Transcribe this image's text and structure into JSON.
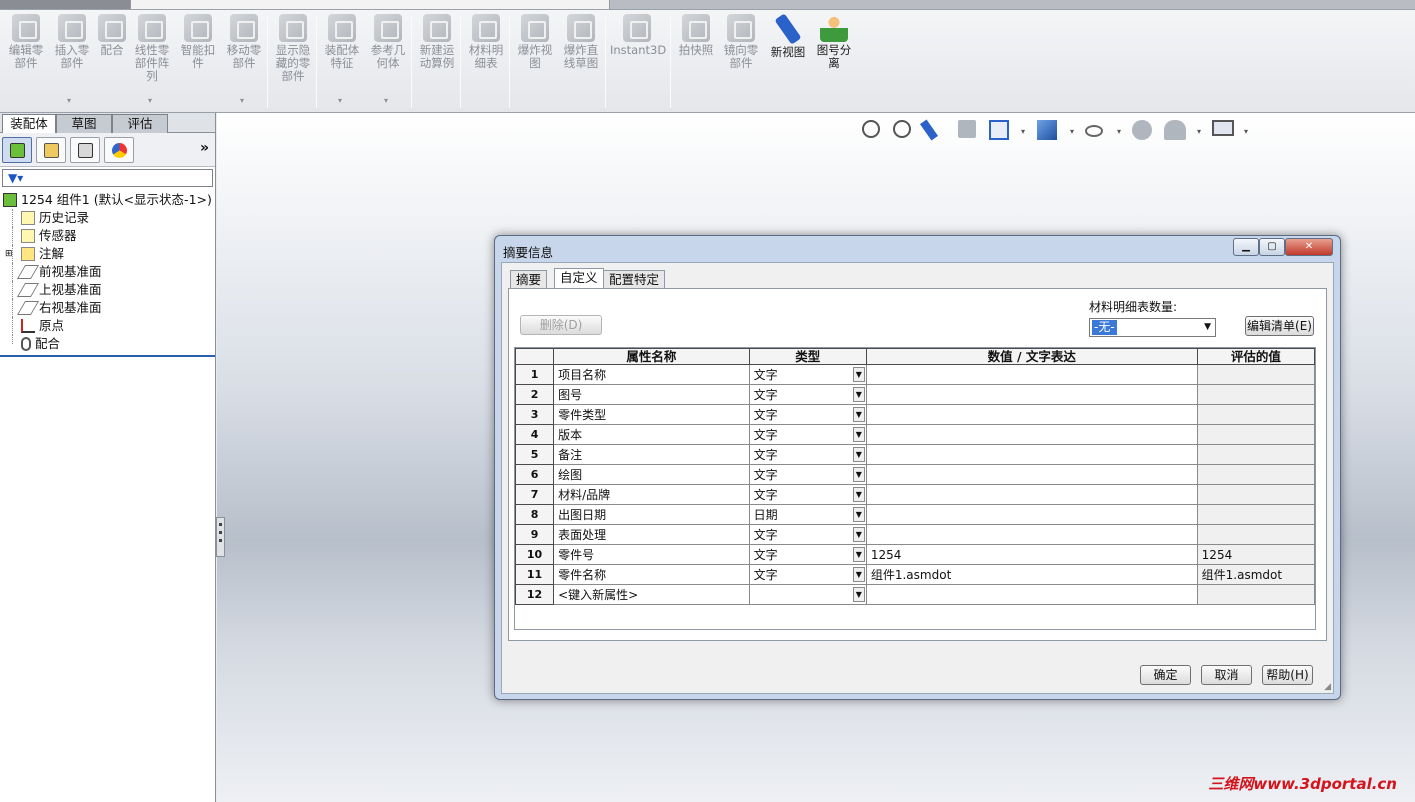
{
  "ribbon": {
    "buttons": [
      {
        "label": "编辑零\n部件",
        "icon": "edit-component-icon"
      },
      {
        "label": "插入零\n部件",
        "icon": "insert-component-icon"
      },
      {
        "label": "配合",
        "icon": "mate-icon"
      },
      {
        "label": "线性零\n部件阵\n列",
        "icon": "linear-pattern-icon"
      },
      {
        "label": "智能扣\n件",
        "icon": "smart-fastener-icon"
      },
      {
        "label": "移动零\n部件",
        "icon": "move-component-icon"
      },
      {
        "label": "显示隐\n藏的零\n部件",
        "icon": "show-hidden-icon"
      },
      {
        "label": "装配体\n特征",
        "icon": "assembly-feature-icon"
      },
      {
        "label": "参考几\n何体",
        "icon": "reference-geometry-icon"
      },
      {
        "label": "新建运\n动算例",
        "icon": "motion-study-icon"
      },
      {
        "label": "材料明\n细表",
        "icon": "bom-icon"
      },
      {
        "label": "爆炸视\n图",
        "icon": "exploded-view-icon"
      },
      {
        "label": "爆炸直\n线草图",
        "icon": "explode-line-sketch-icon"
      },
      {
        "label": "Instant3D",
        "icon": "instant3d-icon"
      },
      {
        "label": "拍快照",
        "icon": "snapshot-icon"
      },
      {
        "label": "镜向零\n部件",
        "icon": "mirror-component-icon"
      },
      {
        "label": "新视图",
        "icon": "new-view-icon"
      },
      {
        "label": "图号分\n离",
        "icon": "drawing-split-icon"
      }
    ]
  },
  "panel": {
    "tabs": [
      "装配体",
      "草图",
      "评估"
    ],
    "tree_root": "1254 组件1  (默认<显示状态-1>)",
    "tree_items": [
      "历史记录",
      "传感器",
      "注解",
      "前视基准面",
      "上视基准面",
      "右视基准面",
      "原点",
      "配合"
    ],
    "more_label": "»"
  },
  "dialog": {
    "title": "摘要信息",
    "tabs": [
      "摘要",
      "自定义",
      "配置特定"
    ],
    "delete_label": "删除(D)",
    "bom_qty_label": "材料明细表数量:",
    "bom_qty_value": "-无-",
    "edit_list_label": "编辑清单(E)",
    "columns": [
      "",
      "属性名称",
      "类型",
      "数值 / 文字表达",
      "评估的值"
    ],
    "rows": [
      {
        "num": "1",
        "name": "项目名称",
        "type": "文字",
        "value": "",
        "evaluated": ""
      },
      {
        "num": "2",
        "name": "图号",
        "type": "文字",
        "value": "",
        "evaluated": ""
      },
      {
        "num": "3",
        "name": "零件类型",
        "type": "文字",
        "value": "",
        "evaluated": ""
      },
      {
        "num": "4",
        "name": "版本",
        "type": "文字",
        "value": "",
        "evaluated": ""
      },
      {
        "num": "5",
        "name": "备注",
        "type": "文字",
        "value": "",
        "evaluated": ""
      },
      {
        "num": "6",
        "name": "绘图",
        "type": "文字",
        "value": "",
        "evaluated": ""
      },
      {
        "num": "7",
        "name": "材料/品牌",
        "type": "文字",
        "value": "",
        "evaluated": ""
      },
      {
        "num": "8",
        "name": "出图日期",
        "type": "日期",
        "value": "",
        "evaluated": ""
      },
      {
        "num": "9",
        "name": "表面处理",
        "type": "文字",
        "value": "",
        "evaluated": ""
      },
      {
        "num": "10",
        "name": "零件号",
        "type": "文字",
        "value": "1254",
        "evaluated": "1254"
      },
      {
        "num": "11",
        "name": "零件名称",
        "type": "文字",
        "value": "组件1.asmdot",
        "evaluated": "组件1.asmdot"
      },
      {
        "num": "12",
        "name": "<键入新属性>",
        "type": "",
        "value": "",
        "evaluated": ""
      }
    ],
    "ok_label": "确定",
    "cancel_label": "取消",
    "help_label": "帮助(H)"
  },
  "watermark": "三维网www.3dportal.cn"
}
